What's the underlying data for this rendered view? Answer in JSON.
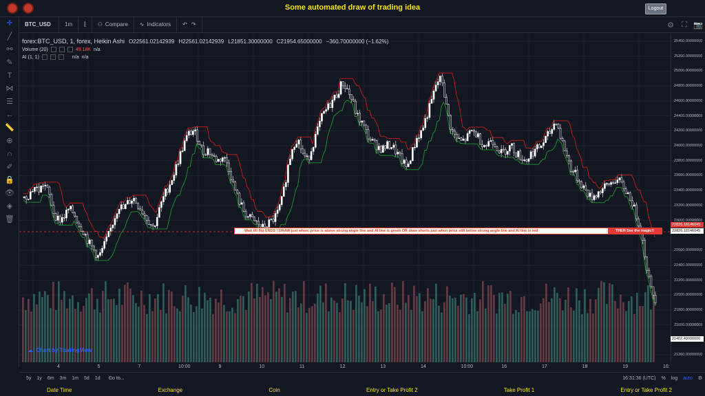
{
  "header": {
    "title": "Some automated draw of trading idea",
    "logout_label": "Logout"
  },
  "toolbar": {
    "symbol": "BTC_USD",
    "interval": "1m",
    "compare_label": "Compare",
    "indicators_label": "Indicators"
  },
  "legend": {
    "series": "forex:BTC_USD, 1, forex, Heikin Ashi",
    "open": "O22561.02142939",
    "high": "H22561.02142939",
    "low": "L21851.30000000",
    "close": "C21954.65000000",
    "change": "−360.70000000 (−1.62%)",
    "volume_label": "Volume (20)",
    "volume_value": "49.18K",
    "volume_na": "n/a",
    "ai_label": "AI (1, 1)",
    "ai_value": "",
    "ai_na1": "n/a",
    "ai_na2": "n/a"
  },
  "banner": {
    "text": "Wait till flip ENDS !   DRAW just when:  price is above strong angle line and AI line is green        OR        draw shorts just when price still below strong angle line and AI line is red",
    "magic": "THEN See the magic!!"
  },
  "price_labels": {
    "red": "22826.18146045",
    "white": "22826.18146045",
    "last": "21402.40000000"
  },
  "yaxis_ticks": [
    "25400.00000000",
    "25200.00000000",
    "25000.00000000",
    "24800.00000000",
    "24600.00000000",
    "24400.00000000",
    "24200.00000000",
    "24000.00000000",
    "23800.00000000",
    "23600.00000000",
    "23400.00000000",
    "23200.00000000",
    "23000.00000000",
    "22600.00000000",
    "22400.00000000",
    "22200.00000000",
    "22000.00000000",
    "21800.00000000",
    "21600.00000000",
    "21200.00000000"
  ],
  "xaxis_ticks": [
    "4",
    "5",
    "7",
    "10:00",
    "9",
    "10",
    "11",
    "12",
    "13",
    "14",
    "10:00",
    "16",
    "17",
    "18",
    "19",
    "16:"
  ],
  "bottombar": {
    "ranges": [
      "5y",
      "1y",
      "6m",
      "3m",
      "1m",
      "5d",
      "1d"
    ],
    "goto": "Go to...",
    "time": "16:31:36 (UTC)",
    "percent": "%",
    "log": "log",
    "auto": "auto"
  },
  "watermark": "Chart by TradingView",
  "footer": [
    "Date Time",
    "Exchange",
    "Coin",
    "Entry or Take Profit 2",
    "Take Profit 1",
    "Entry or Take Profit 2"
  ],
  "colors": {
    "up": "#26a69a",
    "down": "#ef5350",
    "accent": "#f5e50b",
    "ai_green": "#1b8a2e",
    "ai_red": "#b71c1c"
  },
  "chart_data": {
    "type": "candlestick",
    "ylim": [
      21100,
      25500
    ],
    "close_path": [
      23300,
      23350,
      23450,
      23400,
      23500,
      23350,
      23100,
      23000,
      23050,
      23150,
      23100,
      22950,
      22850,
      22700,
      22600,
      22500,
      22650,
      22800,
      23000,
      23200,
      23150,
      23250,
      23300,
      23200,
      23100,
      23000,
      22900,
      23100,
      23300,
      23450,
      23600,
      23800,
      24000,
      24150,
      24200,
      24100,
      23900,
      23950,
      23850,
      23800,
      23850,
      23750,
      23500,
      23300,
      23150,
      23050,
      23000,
      22950,
      22900,
      22950,
      23000,
      23100,
      23300,
      23700,
      24000,
      24100,
      23900,
      23800,
      24000,
      24200,
      24400,
      24500,
      24600,
      24700,
      24850,
      24750,
      24600,
      24400,
      24300,
      24150,
      24050,
      24000,
      23950,
      24000,
      24000,
      23900,
      23800,
      23700,
      23900,
      24100,
      24200,
      24400,
      24600,
      24850,
      24900,
      24500,
      24200,
      24100,
      24050,
      24100,
      24200,
      24150,
      24050,
      24000,
      24100,
      24000,
      23900,
      23950,
      24000,
      23900,
      23850,
      23800,
      23900,
      23950,
      24000,
      24100,
      24200,
      24350,
      24100,
      23900,
      23700,
      23600,
      23500,
      23400,
      23300,
      23350,
      23400,
      23450,
      23500,
      23550,
      23500,
      23400,
      23300,
      23100,
      22900,
      22500,
      22100,
      21950
    ]
  }
}
